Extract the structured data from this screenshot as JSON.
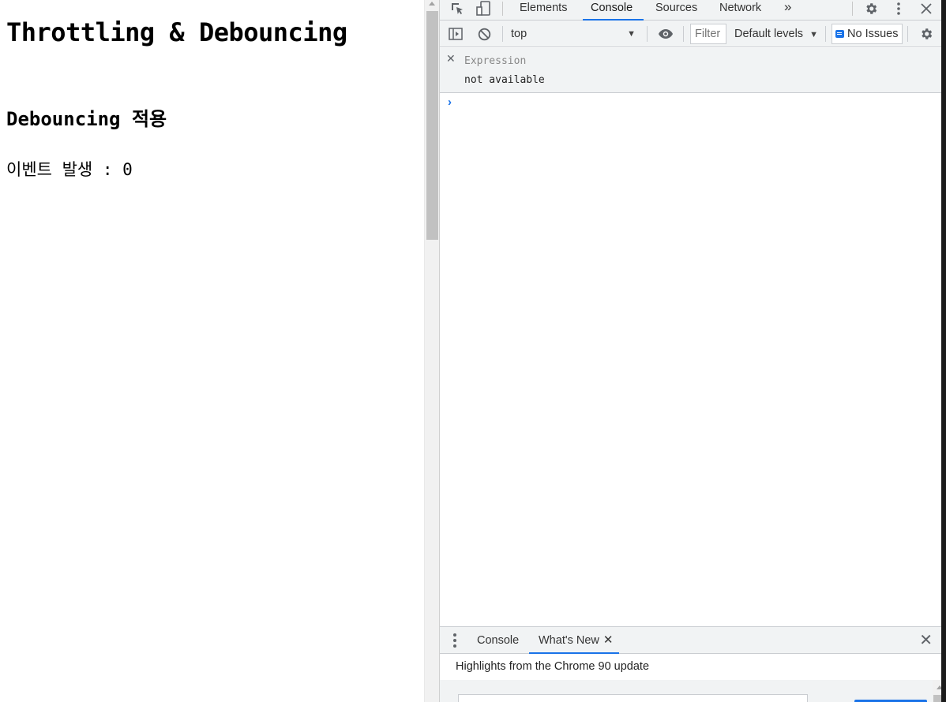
{
  "page": {
    "title": "Throttling & Debouncing",
    "subtitle": "Debouncing 적용",
    "counter_label": "이벤트 발생 : 0"
  },
  "devtools": {
    "tabs": [
      {
        "label": "Elements",
        "active": false
      },
      {
        "label": "Console",
        "active": true
      },
      {
        "label": "Sources",
        "active": false
      },
      {
        "label": "Network",
        "active": false
      }
    ],
    "more_tabs_glyph": "»",
    "toolbar": {
      "context": "top",
      "filter_placeholder": "Filter",
      "levels": "Default levels",
      "issues": "No Issues"
    },
    "live_expression": {
      "expression": "Expression",
      "value": "not available"
    },
    "console_prompt": "›",
    "drawer": {
      "tabs": [
        {
          "label": "Console",
          "active": false
        },
        {
          "label": "What's New",
          "active": true
        }
      ],
      "headline": "Highlights from the Chrome 90 update"
    },
    "icons": [
      "inspect-icon",
      "device-toggle-icon",
      "settings-icon",
      "kebab-menu-icon",
      "close-icon",
      "sidebar-toggle-icon",
      "clear-console-icon",
      "eye-icon",
      "issues-icon"
    ],
    "colors": {
      "accent": "#1a73e8",
      "toolbar_bg": "#f1f3f4"
    }
  }
}
